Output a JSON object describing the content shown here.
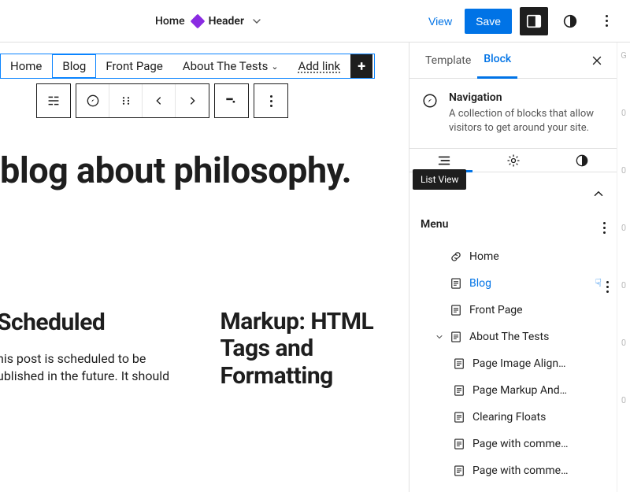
{
  "colors": {
    "accent": "#0073e6",
    "ink": "#1e1e1e"
  },
  "topbar": {
    "doc_title": "Home",
    "header_label": "Header",
    "view_label": "View",
    "save_label": "Save"
  },
  "canvas": {
    "nav_items": [
      "Home",
      "Blog",
      "Front Page",
      "About The Tests"
    ],
    "add_link_label": "Add link",
    "hero": "blog about philosophy.",
    "post1": {
      "title": "Scheduled",
      "body": "his post is scheduled to be ublished in the future. It should"
    },
    "post2": {
      "title": "Markup: HTML Tags and",
      "body2": "Formatting"
    }
  },
  "sidebar": {
    "tabs": {
      "template": "Template",
      "block": "Block"
    },
    "block": {
      "title": "Navigation",
      "desc": "A collection of blocks that allow visitors to get around your site."
    },
    "list_view_tooltip": "List View",
    "menu_label": "Menu",
    "tree": [
      {
        "icon": "link",
        "label": "Home",
        "depth": 0
      },
      {
        "icon": "page",
        "label": "Blog",
        "depth": 0,
        "selected": true,
        "hover": true
      },
      {
        "icon": "page",
        "label": "Front Page",
        "depth": 0
      },
      {
        "icon": "page",
        "label": "About The Tests",
        "depth": 0,
        "expandable": true,
        "expanded": true
      },
      {
        "icon": "page",
        "label": "Page Image Align…",
        "depth": 1
      },
      {
        "icon": "page",
        "label": "Page Markup And…",
        "depth": 1
      },
      {
        "icon": "page",
        "label": "Clearing Floats",
        "depth": 1
      },
      {
        "icon": "page",
        "label": "Page with comme…",
        "depth": 1
      },
      {
        "icon": "page",
        "label": "Page with comme…",
        "depth": 1
      }
    ]
  },
  "gutter": [
    "G",
    "0",
    "0",
    "0",
    "0",
    "0",
    "0"
  ]
}
